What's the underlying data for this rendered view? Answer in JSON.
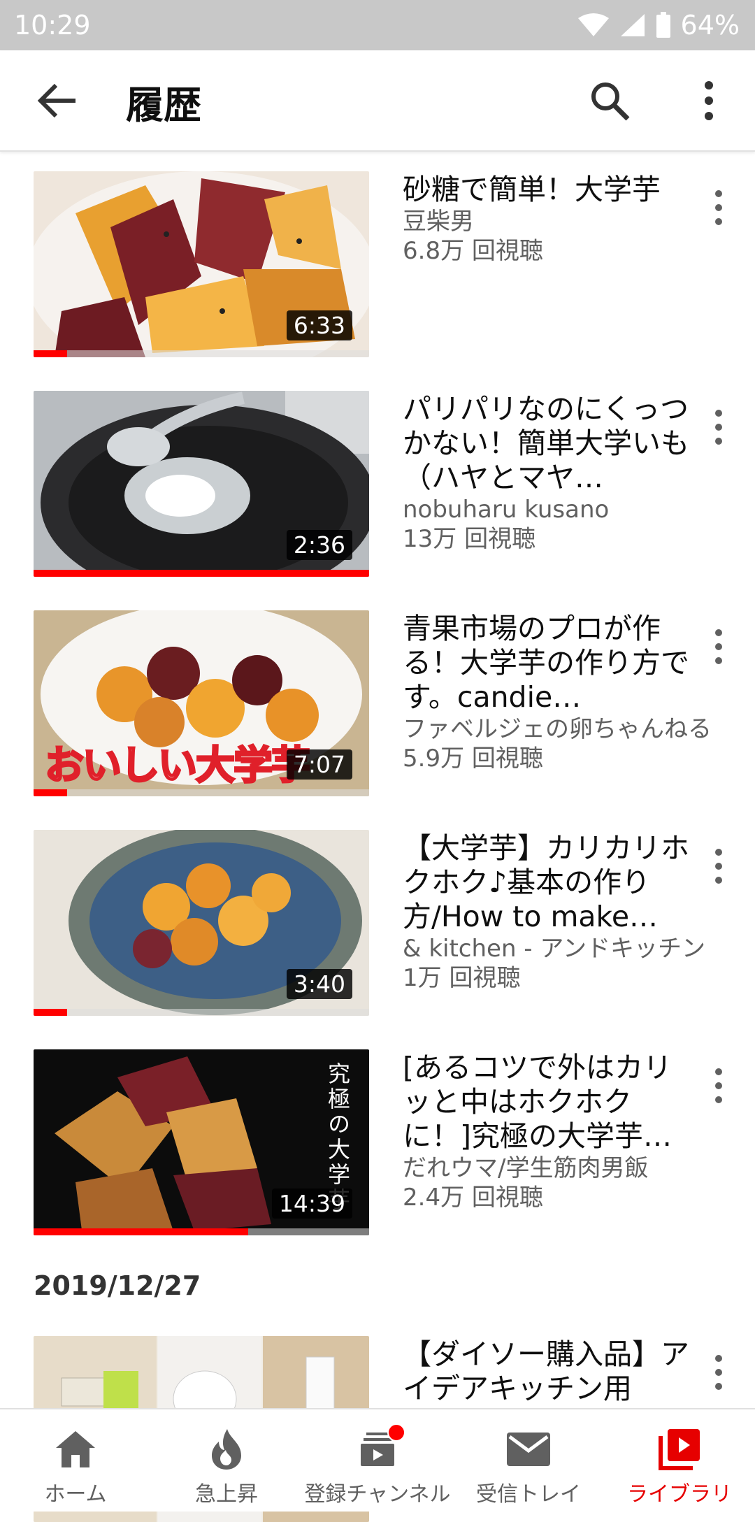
{
  "status_bar": {
    "time": "10:29",
    "battery": "64%"
  },
  "app_bar": {
    "title": "履歴"
  },
  "date_header": "2019/12/27",
  "videos": [
    {
      "title": "砂糖で簡単！大学芋",
      "channel": "豆柴男",
      "views": "6.8万 回視聴",
      "duration": "6:33",
      "progress": 0.1
    },
    {
      "title": "パリパリなのにくっつかない！簡単大学いも（ハヤとマヤ…",
      "channel": "nobuharu kusano",
      "views": "13万 回視聴",
      "duration": "2:36",
      "progress": 1.0
    },
    {
      "title": "青果市場のプロが作る！大学芋の作り方です。candie…",
      "channel": "ファベルジェの卵ちゃんねる",
      "views": "5.9万 回視聴",
      "duration": "7:07",
      "progress": 0.1,
      "overlay_text": "おいしい大学芋"
    },
    {
      "title": "【大学芋】カリカリホクホク♪基本の作り方/How to make…",
      "channel": "& kitchen - アンドキッチン",
      "views": "1万 回視聴",
      "duration": "3:40",
      "progress": 0.1
    },
    {
      "title": "[あるコツで外はカリッと中はホクホクに！]究極の大学芋…",
      "channel": "だれウマ/学生筋肉男飯",
      "views": "2.4万 回視聴",
      "duration": "14:39",
      "progress": 0.64,
      "overlay_text": "究極の大学芋"
    },
    {
      "title": "【ダイソー購入品】アイデアキッチン用"
    }
  ],
  "bottom_nav": [
    {
      "label": "ホーム",
      "icon": "home-icon"
    },
    {
      "label": "急上昇",
      "icon": "trending-fire-icon"
    },
    {
      "label": "登録チャンネル",
      "icon": "subscriptions-icon",
      "badge": true
    },
    {
      "label": "受信トレイ",
      "icon": "inbox-mail-icon"
    },
    {
      "label": "ライブラリ",
      "icon": "library-icon",
      "active": true
    }
  ],
  "colors": {
    "accent": "#ff0000",
    "active_nav": "#e60000",
    "secondary_text": "#606060"
  }
}
